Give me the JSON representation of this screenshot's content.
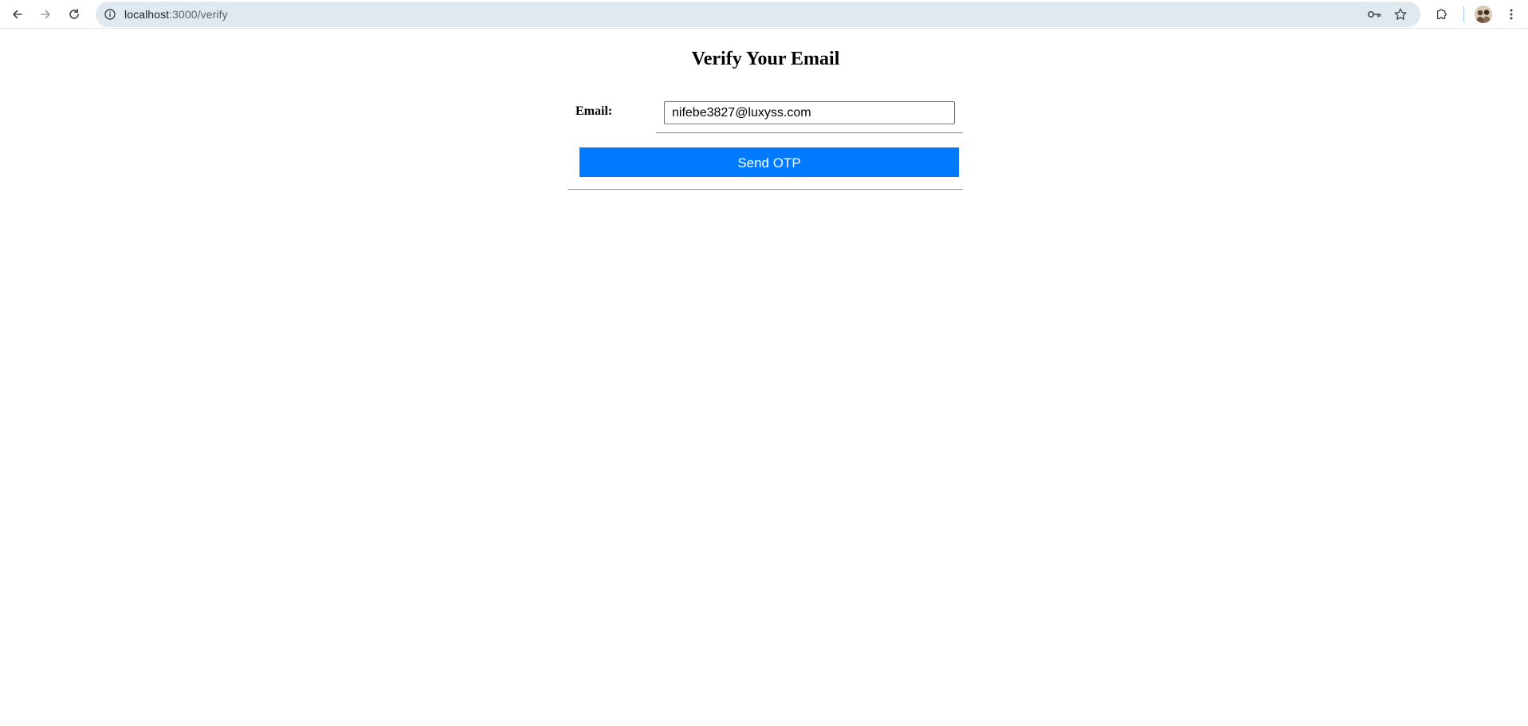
{
  "browser": {
    "url_host": "localhost",
    "url_rest": ":3000/verify",
    "icons": {
      "back": "arrow-left-icon",
      "forward": "arrow-right-icon",
      "reload": "reload-icon",
      "site_info": "info-icon",
      "passwords": "key-icon",
      "bookmark": "star-icon",
      "extensions": "puzzle-icon",
      "profile": "avatar",
      "menu": "kebab-menu-icon"
    }
  },
  "page": {
    "title": "Verify Your Email",
    "email_label": "Email:",
    "email_value": "nifebe3827@luxyss.com",
    "send_button_label": "Send OTP",
    "accent_color": "#007bff"
  }
}
